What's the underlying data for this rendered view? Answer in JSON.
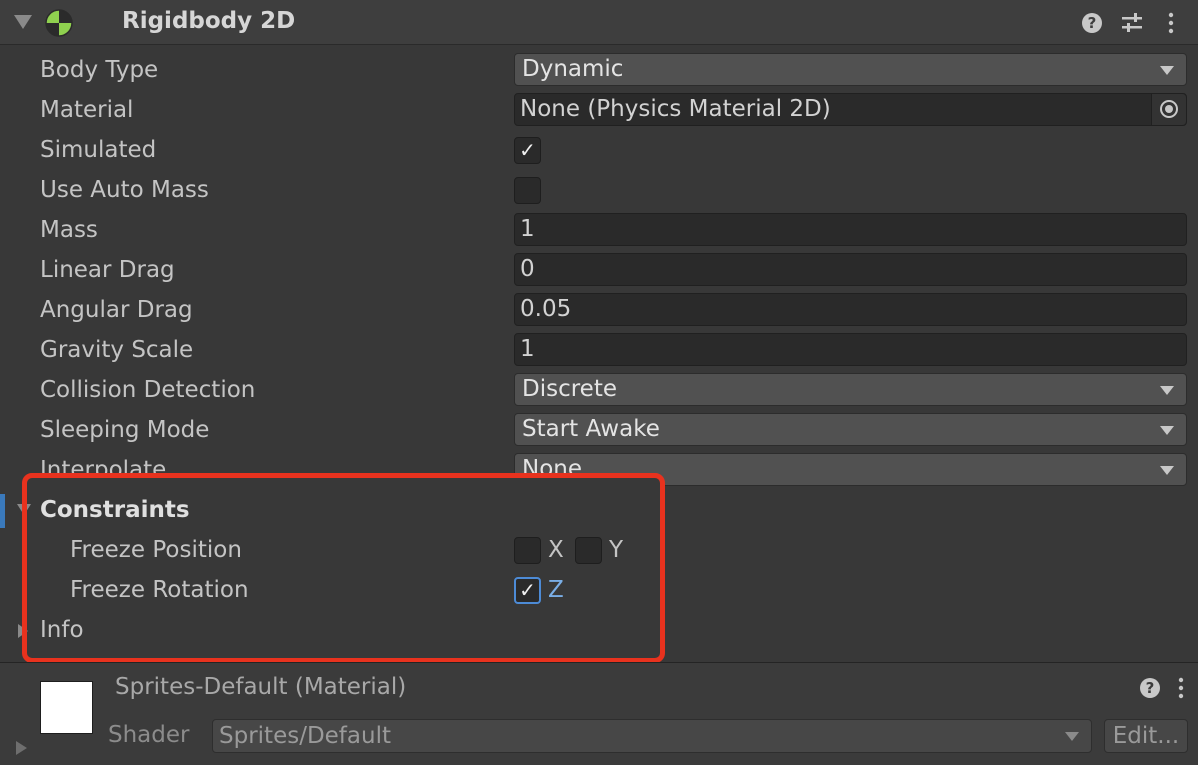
{
  "component": {
    "title": "Rigidbody 2D",
    "icon": "rigidbody-2d-icon",
    "header_icons": [
      "help-icon",
      "presets-icon",
      "kebab-menu-icon"
    ]
  },
  "fields": {
    "body_type": {
      "label": "Body Type",
      "value": "Dynamic"
    },
    "material": {
      "label": "Material",
      "value": "None (Physics Material 2D)"
    },
    "simulated": {
      "label": "Simulated",
      "checked": true
    },
    "use_auto_mass": {
      "label": "Use Auto Mass",
      "checked": false
    },
    "mass": {
      "label": "Mass",
      "value": "1"
    },
    "linear_drag": {
      "label": "Linear Drag",
      "value": "0"
    },
    "angular_drag": {
      "label": "Angular Drag",
      "value": "0.05"
    },
    "gravity_scale": {
      "label": "Gravity Scale",
      "value": "1"
    },
    "collision_detection": {
      "label": "Collision Detection",
      "value": "Discrete"
    },
    "sleeping_mode": {
      "label": "Sleeping Mode",
      "value": "Start Awake"
    },
    "interpolate": {
      "label": "Interpolate",
      "value": "None"
    }
  },
  "constraints": {
    "label": "Constraints",
    "freeze_position": {
      "label": "Freeze Position",
      "x_label": "X",
      "x_checked": false,
      "y_label": "Y",
      "y_checked": false
    },
    "freeze_rotation": {
      "label": "Freeze Rotation",
      "z_label": "Z",
      "z_checked": true
    }
  },
  "info": {
    "label": "Info"
  },
  "material_section": {
    "name": "Sprites-Default (Material)",
    "shader_label": "Shader",
    "shader_value": "Sprites/Default",
    "edit_label": "Edit..."
  },
  "colors": {
    "background": "#383838",
    "highlight_box": "#e8321e",
    "focus_blue": "#4d8bd6"
  }
}
